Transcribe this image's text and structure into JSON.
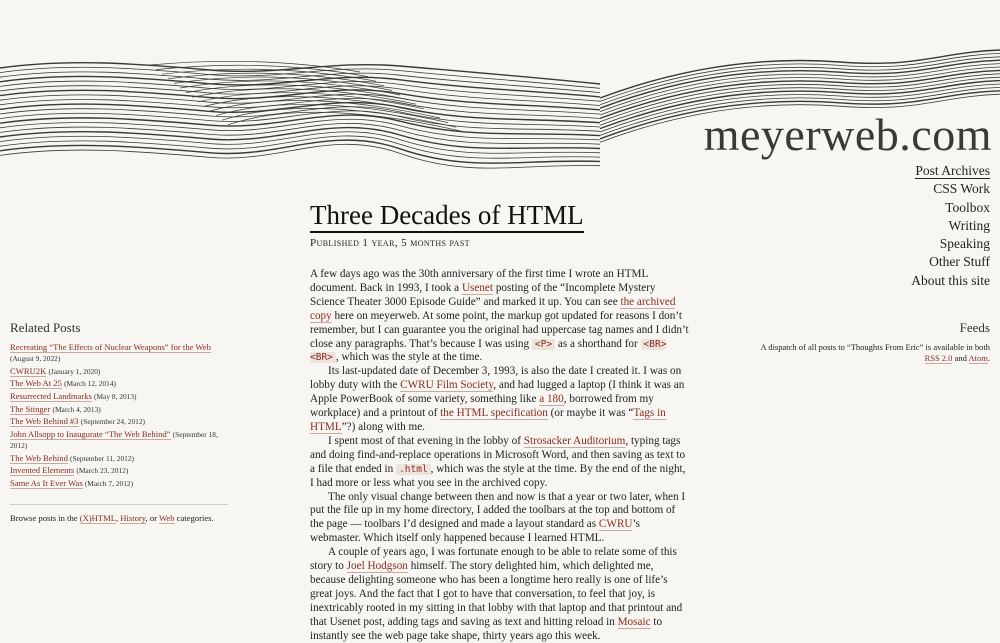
{
  "site": {
    "title": "meyerweb.com"
  },
  "nav": [
    {
      "label": "Post Archives",
      "current": true
    },
    {
      "label": "CSS Work"
    },
    {
      "label": "Toolbox"
    },
    {
      "label": "Writing"
    },
    {
      "label": "Speaking"
    },
    {
      "label": "Other Stuff"
    },
    {
      "label": "About this site"
    }
  ],
  "post": {
    "title": "Three Decades of HTML",
    "meta": "Published 1 year, 5 months past",
    "p1": {
      "a": "A few days ago was the 30th anniversary of the first time I wrote an HTML document.  Back in 1993, I took a ",
      "link1": "Usenet",
      "b": " posting of the “Incomplete Mystery Science Theater 3000 Episode Guide” and marked it up.  You can see ",
      "link2": "the archived copy",
      "c": " here on meyerweb.  At some point, the markup got updated for reasons I don’t remember, but I can guarantee you the original had uppercase tag names and I didn’t close any paragraphs.  That’s because I was using ",
      "code1": "<P>",
      "d": " as a shorthand for ",
      "code2": "<BR><BR>",
      "e": ", which was the style at the time."
    },
    "p2": {
      "a": "Its last-updated date of December 3, 1993, is also the date I created it.  I was on lobby duty with the ",
      "link1": "CWRU Film Society",
      "b": ", and had lugged a laptop (I think it was an Apple PowerBook of some variety, something like ",
      "link2": "a 180",
      "c": ", borrowed from my workplace) and a printout of ",
      "link3": "the HTML specification",
      "d": " (or maybe it was “",
      "link4": "Tags in HTML",
      "e": "”?) along with me."
    },
    "p3": {
      "a": "I spent most of that evening in the lobby of ",
      "link1": "Strosacker Auditorium",
      "b": ", typing tags and doing find-and-replace operations in Microsoft Word, and then saving as text to a file that ended in ",
      "code1": ".html",
      "c": ", which was the style at the time.  By the end of the night, I had more or less what you see in the archived copy."
    },
    "p4": {
      "a": "The only visual change between then and now is that a year or two later, when I put the file up in my home directory, I added the toolbars at the top and bottom of the page — toolbars I’d designed and made a layout standard as ",
      "link1": "CWRU",
      "b": "’s webmaster.  Which itself only happened because I learned HTML."
    },
    "p5": {
      "a": "A couple of years ago, I was fortunate enough to be able to relate some of this story to ",
      "link1": "Joel Hodgson",
      "b": " himself.  The story delighted him, which delighted me, because delighting someone who has been a longtime hero really is one of life’s great joys.  And the fact that I got to have that conversation, to feel that joy, is inextricably rooted in my sitting in that lobby with that laptop and that printout and that Usenet post, adding tags and saving as text and hitting reload in ",
      "link2": "Mosaic",
      "c": " to instantly see the web page take shape, thirty years ago this week."
    }
  },
  "related": {
    "heading": "Related Posts",
    "items": [
      {
        "title": "Recreating “The Effects of Nuclear Weapons” for the Web",
        "date": "(August 9, 2022)"
      },
      {
        "title": "CWRU2K",
        "date": "(January 1, 2020)"
      },
      {
        "title": "The Web At 25",
        "date": "(March 12, 2014)"
      },
      {
        "title": "Resurrected Landmarks",
        "date": "(May 8, 2013)"
      },
      {
        "title": "The Stinger",
        "date": "(March 4, 2013)"
      },
      {
        "title": "The Web Behind #3",
        "date": "(September 24, 2012)"
      },
      {
        "title": "John Allsopp to Inaugurate “The Web Behind”",
        "date": "(September 18, 2012)"
      },
      {
        "title": "The Web Behind",
        "date": "(September 11, 2012)"
      },
      {
        "title": "Invented Elements",
        "date": "(March 23, 2012)"
      },
      {
        "title": "Same As It Ever Was",
        "date": "(March 7, 2012)"
      }
    ],
    "browse": {
      "prefix": "Browse posts in the ",
      "cat1": "(X)HTML",
      "sep1": ", ",
      "cat2": "History",
      "sep2": ", or ",
      "cat3": "Web",
      "suffix": " categories."
    }
  },
  "feeds": {
    "heading": "Feeds",
    "text_a": "A dispatch of all posts to “Thoughts From Eric” is available in both ",
    "rss": "RSS 2.0",
    "and": " and ",
    "atom": "Atom",
    "end": "."
  }
}
